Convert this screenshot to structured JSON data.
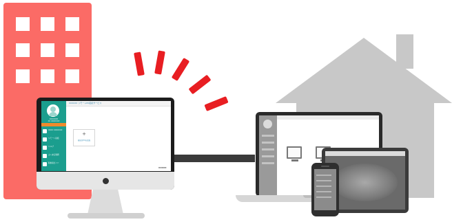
{
  "scene": {
    "icons": {
      "office": "office-building-icon",
      "home": "house-icon",
      "signal": "wireless-signal-icon",
      "desktop": "desktop-monitor-icon",
      "laptop": "laptop-icon",
      "tablet": "tablet-icon",
      "phone": "smartphone-icon"
    },
    "colors": {
      "building": "#fb6b66",
      "signal": "#e81e22",
      "house": "#c8c8c8",
      "app_sidebar": "#1b9e8e",
      "app_accent": "#f08a2c"
    }
  },
  "monitor_app": {
    "user_line1": "XXXXXXX",
    "user_line2": "XX XXXXXXX",
    "breadcrumb": "XXXXXX リモートPC接続サービス",
    "nav": [
      {
        "label": "XXXX XXXXXXX"
      },
      {
        "label": "リモート接続"
      },
      {
        "label": "ヘルプ"
      },
      {
        "label": "よくある質問"
      },
      {
        "label": "利用者ガイド"
      }
    ],
    "card_plus": "+",
    "card_label": "接続先PCを追加",
    "brand": "XXXXX"
  }
}
